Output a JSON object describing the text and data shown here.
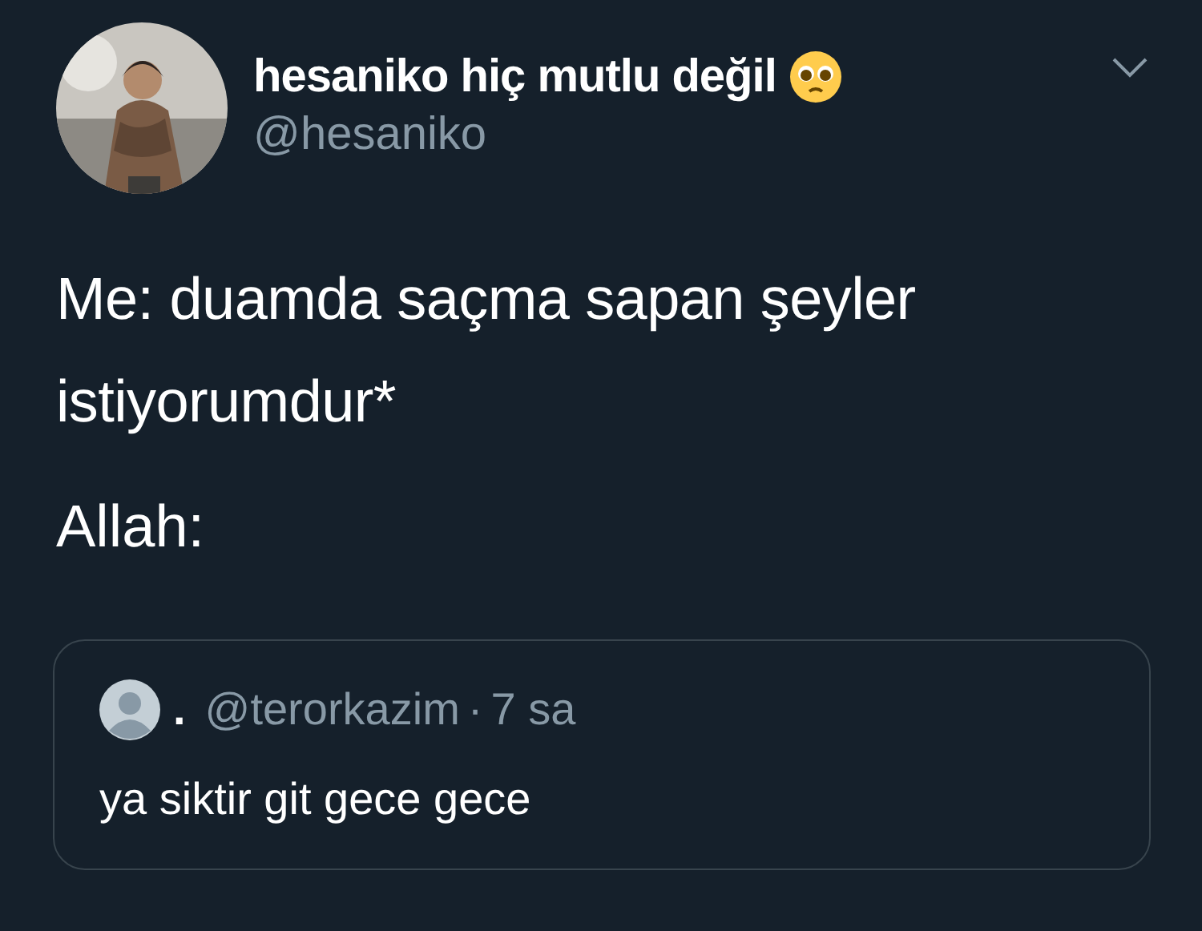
{
  "tweet": {
    "display_name": "hesaniko hiç mutlu değil",
    "handle": "@hesaniko",
    "body": [
      "Me: duamda saçma sapan şeyler istiyorumdur*",
      "Allah:"
    ],
    "quoted": {
      "display_name": ".",
      "handle": "@terorkazim",
      "separator": "·",
      "time": "7 sa",
      "text": "ya siktir git gece gece"
    }
  }
}
